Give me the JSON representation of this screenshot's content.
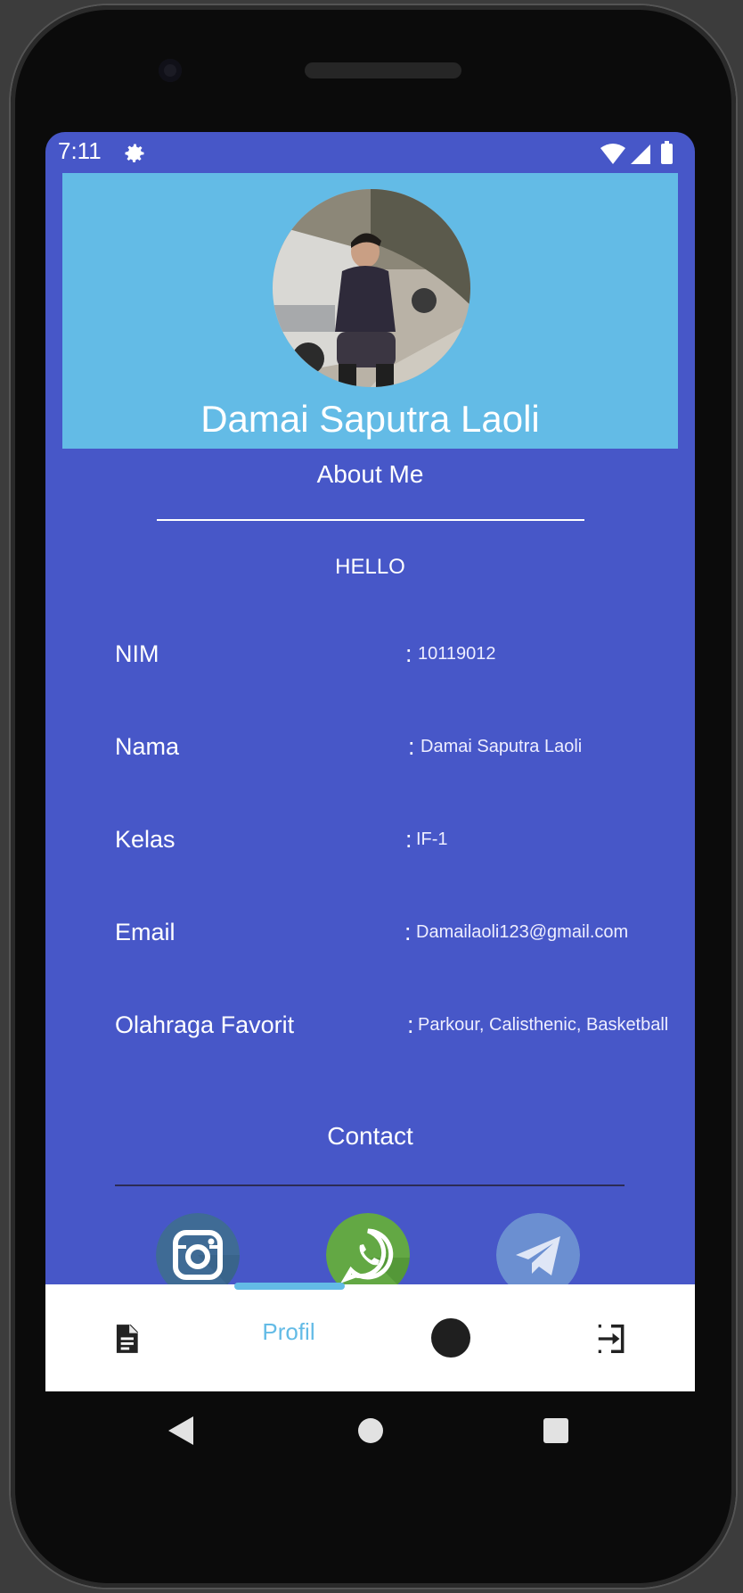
{
  "status_bar": {
    "time": "7:11"
  },
  "profile": {
    "name": "Damai Saputra Laoli"
  },
  "about": {
    "title": "About Me",
    "greeting": "HELLO",
    "fields": [
      {
        "label": "NIM",
        "value": "10119012"
      },
      {
        "label": "Nama",
        "value": "Damai Saputra Laoli"
      },
      {
        "label": "Kelas",
        "value": "IF-1"
      },
      {
        "label": "Email",
        "value": "Damailaoli123@gmail.com"
      },
      {
        "label": "Olahraga Favorit",
        "value": "Parkour, Calisthenic, Basketball"
      }
    ],
    "separator": ":"
  },
  "contact": {
    "title": "Contact",
    "items": [
      {
        "icon": "instagram-icon"
      },
      {
        "icon": "whatsapp-icon"
      },
      {
        "icon": "telegram-icon"
      }
    ]
  },
  "bottom_nav": {
    "items": [
      {
        "icon": "document-icon"
      },
      {
        "label": "Profil",
        "active": true
      },
      {
        "icon": "circle-icon"
      },
      {
        "icon": "logout-icon"
      }
    ]
  },
  "colors": {
    "background": "#4757c8",
    "header": "#63bbe6",
    "accent": "#63bbe6",
    "nav_background": "#ffffff"
  }
}
